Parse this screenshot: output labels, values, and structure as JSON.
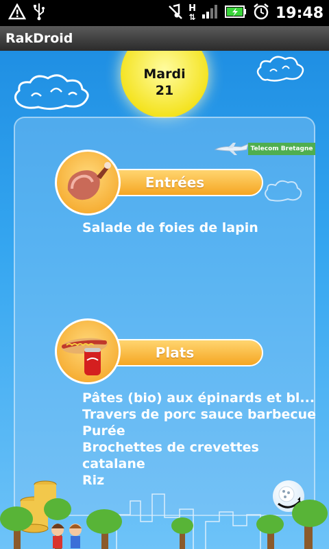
{
  "statusbar": {
    "time": "19:48",
    "icons": [
      "warning-icon",
      "usb-icon",
      "music-muted-icon",
      "network-h-icon",
      "signal-icon",
      "battery-charging-icon",
      "alarm-icon"
    ],
    "network_label": "H"
  },
  "app": {
    "title": "RakDroid"
  },
  "date": {
    "day_name": "Mardi",
    "day_number": "21"
  },
  "banner": {
    "label": "Telecom Bretagne"
  },
  "sections": [
    {
      "label": "Entrées",
      "icon": "ham-icon",
      "items": [
        "Salade de foies de lapin"
      ]
    },
    {
      "label": "Plats",
      "icon": "hotdog-soda-icon",
      "items": [
        "Pâtes (bio) aux épinards et bl...",
        "Travers de porc sauce barbecue",
        "Purée",
        "Brochettes de crevettes",
        "catalane",
        "Riz"
      ]
    }
  ],
  "colors": {
    "sky": "#1f8fe3",
    "pill": "#f5a623",
    "sun": "#f4e320",
    "status": "#000000"
  }
}
